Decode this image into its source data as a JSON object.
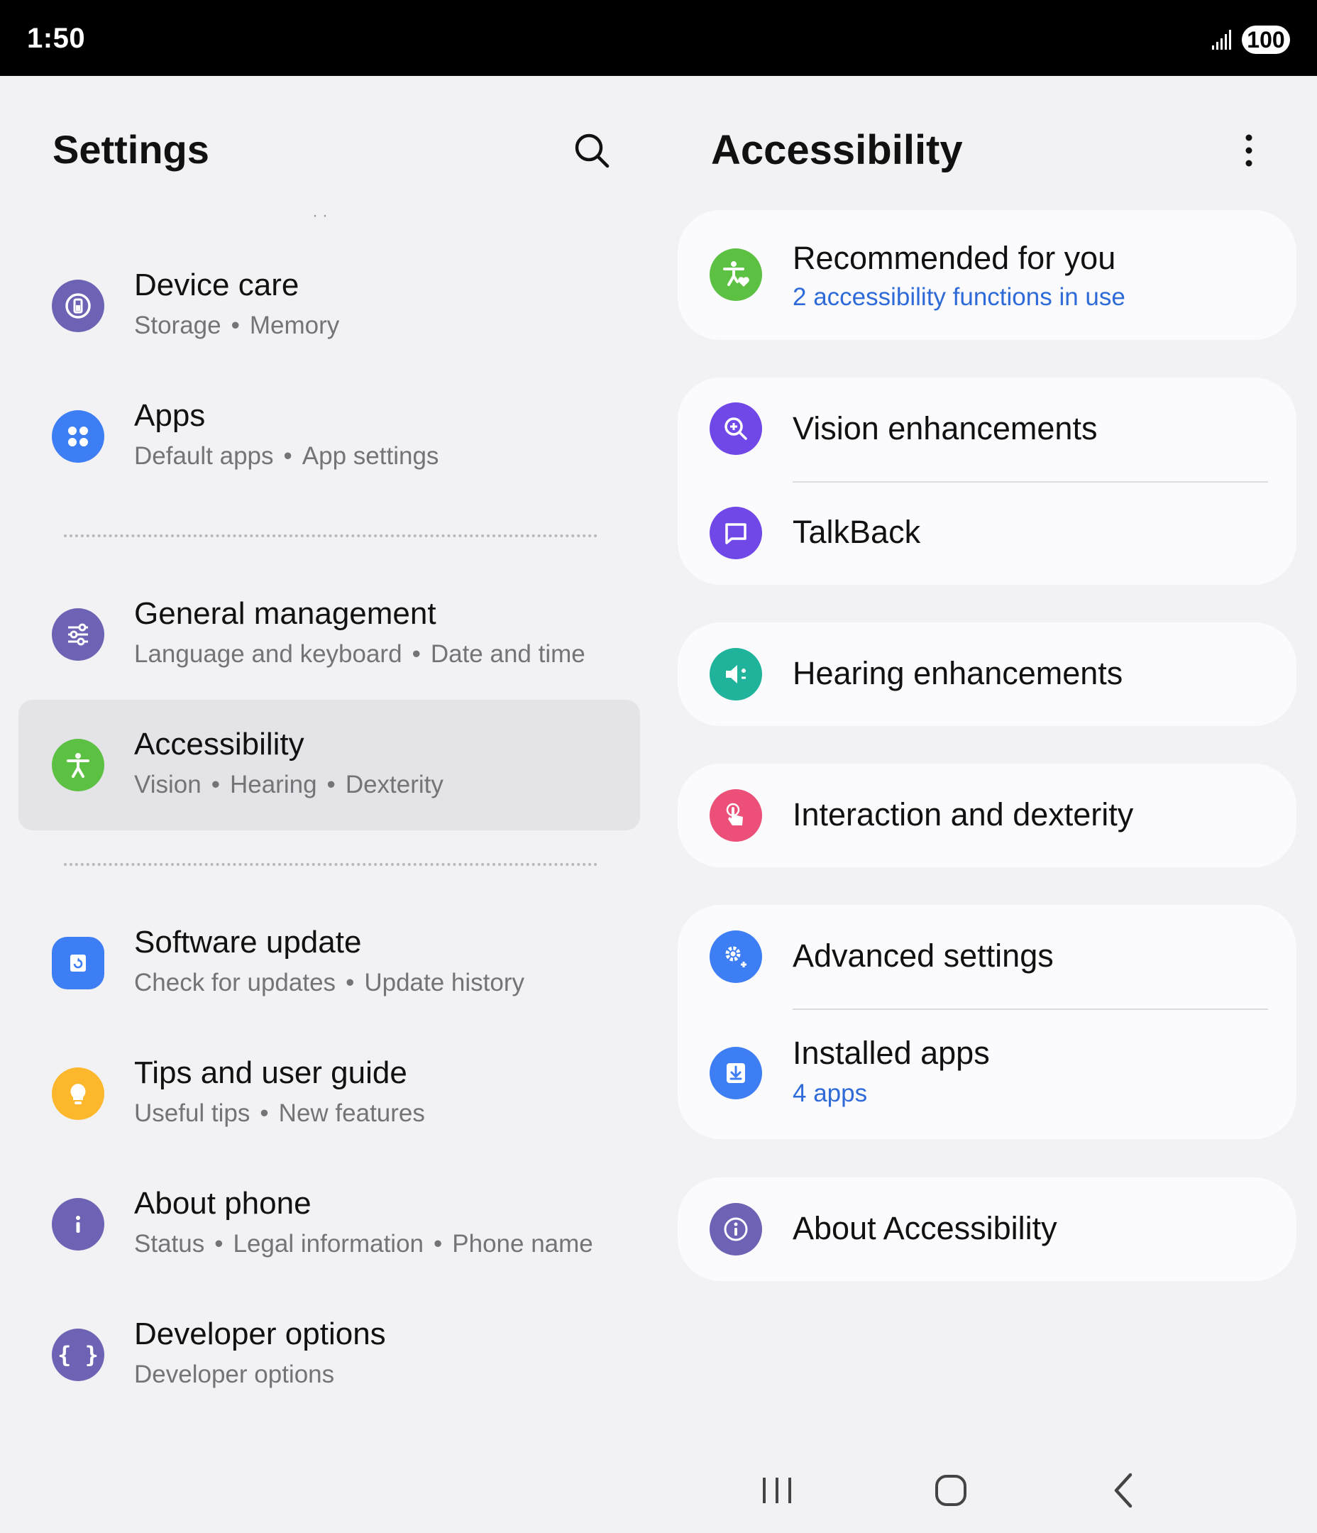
{
  "status_bar": {
    "time": "1:50",
    "battery": "100",
    "signal_icon": "signal-icon"
  },
  "left_panel": {
    "title": "Settings",
    "search_icon": "search-icon",
    "items": [
      {
        "title": "Device care",
        "sub1": "Storage",
        "sub2": "Memory",
        "icon": "device-care-icon",
        "color": "#6c63b5"
      },
      {
        "title": "Apps",
        "sub1": "Default apps",
        "sub2": "App settings",
        "icon": "apps-icon",
        "color": "#3d7ef5"
      },
      {
        "title": "General management",
        "sub1": "Language and keyboard",
        "sub2": "Date and time",
        "icon": "sliders-icon",
        "color": "#6c63b5"
      },
      {
        "title": "Accessibility",
        "sub1": "Vision",
        "sub2": "Hearing",
        "sub3": "Dexterity",
        "icon": "accessibility-icon",
        "color": "#5cc042",
        "selected": true
      },
      {
        "title": "Software update",
        "sub1": "Check for updates",
        "sub2": "Update history",
        "icon": "software-update-icon",
        "color": "#3d7ef5"
      },
      {
        "title": "Tips and user guide",
        "sub1": "Useful tips",
        "sub2": "New features",
        "icon": "lightbulb-icon",
        "color": "#fdb72c"
      },
      {
        "title": "About phone",
        "sub1": "Status",
        "sub2": "Legal information",
        "sub3": "Phone name",
        "icon": "info-icon",
        "color": "#6c63b5"
      },
      {
        "title": "Developer options",
        "sub1": "Developer options",
        "icon": "code-braces-icon",
        "color": "#6c63b5"
      }
    ]
  },
  "right_panel": {
    "title": "Accessibility",
    "more_icon": "more-vertical-icon",
    "recommended": {
      "title": "Recommended for you",
      "sub": "2 accessibility functions in use",
      "icon": "accessibility-heart-icon",
      "color": "#5cc042"
    },
    "vision": {
      "title": "Vision enhancements",
      "icon": "magnifier-plus-icon",
      "color": "#7048e8"
    },
    "talkback": {
      "title": "TalkBack",
      "icon": "chat-bubble-icon",
      "color": "#7048e8"
    },
    "hearing": {
      "title": "Hearing enhancements",
      "icon": "speaker-icon",
      "color": "#1fb39b"
    },
    "interaction": {
      "title": "Interaction and dexterity",
      "icon": "touch-hand-icon",
      "color": "#ec4f78"
    },
    "advanced": {
      "title": "Advanced settings",
      "icon": "gear-plus-icon",
      "color": "#3d7ef5"
    },
    "installed": {
      "title": "Installed apps",
      "sub": "4 apps",
      "icon": "download-icon",
      "color": "#3d7ef5"
    },
    "about": {
      "title": "About Accessibility",
      "icon": "info-icon",
      "color": "#6c63b5"
    }
  },
  "nav_bar": {
    "recents_icon": "recents-icon",
    "home_icon": "home-icon",
    "back_icon": "back-icon"
  }
}
